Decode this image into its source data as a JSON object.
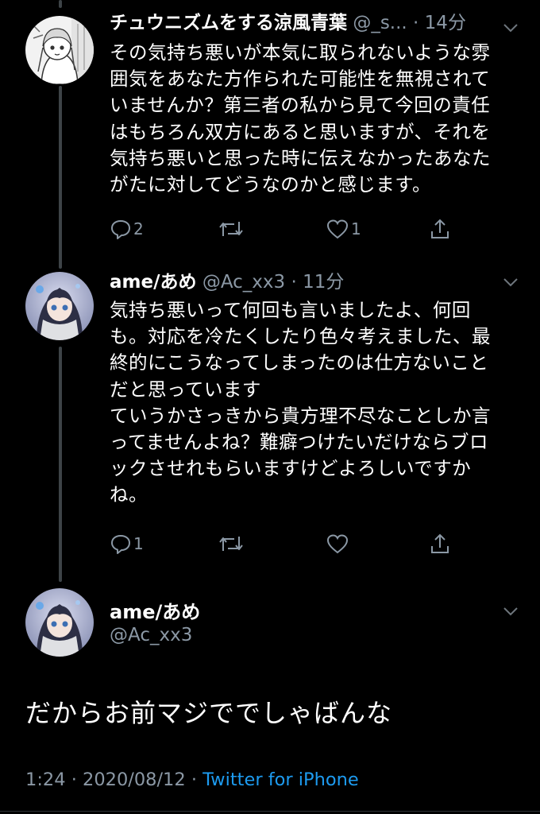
{
  "tweet1": {
    "display_name": "チュウニズムをする涼風青葉",
    "handle": "@_s...",
    "time": "14分",
    "text": "その気持ち悪いが本気に取られないような雰\n囲気をあなた方作られた可能性を無視されて\nいませんか？第三者の私から見て今回の責任\nはもちろん双方にあると思いますが、それを\n気持ち悪いと思った時に伝えなかったあなた\nがたに対してどうなのかと感じます。",
    "reply_count": "2",
    "retweet_count": "",
    "like_count": "1"
  },
  "tweet2": {
    "display_name": "ame/あめ",
    "handle": "@Ac_xx3",
    "time": "11分",
    "text": "気持ち悪いって何回も言いましたよ、何回\nも。対応を冷たくしたり色々考えました、最\n終的にこうなってしまったのは仕方ないこと\nだと思っています\nていうかさっきから貴方理不尽なことしか言\nってませんよね？難癖つけたいだけならブロ\nックさせれもらいますけどよろしいですか\nね。",
    "reply_count": "1",
    "retweet_count": "",
    "like_count": ""
  },
  "main_tweet": {
    "display_name": "ame/あめ",
    "handle": "@Ac_xx3",
    "text": "だからお前マジででしゃばんな",
    "time": "1:24",
    "date": "2020/08/12",
    "source": "Twitter for iPhone",
    "separator": "·"
  },
  "icons": [
    "reply-icon",
    "retweet-icon",
    "like-icon",
    "share-icon",
    "chevron-down-icon"
  ],
  "colors": {
    "background": "#000000",
    "text": "#ffffff",
    "muted": "#8b98a5",
    "link": "#1d9bf0",
    "thread_line": "#3d4347"
  }
}
